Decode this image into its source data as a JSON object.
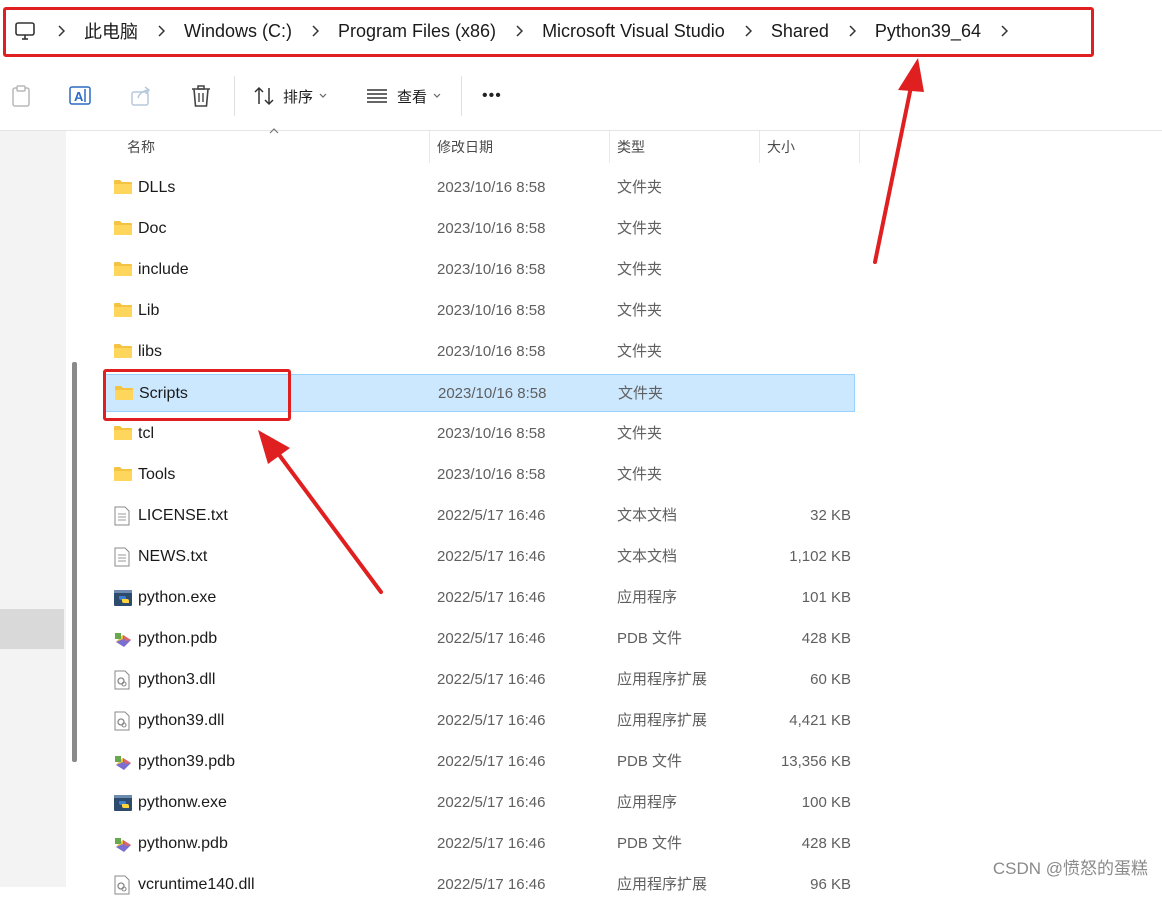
{
  "breadcrumb": {
    "items": [
      "此电脑",
      "Windows (C:)",
      "Program Files (x86)",
      "Microsoft Visual Studio",
      "Shared",
      "Python39_64"
    ]
  },
  "toolbar": {
    "sort_label": "排序",
    "view_label": "查看",
    "more_label": "•••"
  },
  "columns": {
    "name": "名称",
    "date": "修改日期",
    "type": "类型",
    "size": "大小"
  },
  "files": [
    {
      "name": "DLLs",
      "date": "2023/10/16 8:58",
      "type": "文件夹",
      "size": "",
      "icon": "folder-icon"
    },
    {
      "name": "Doc",
      "date": "2023/10/16 8:58",
      "type": "文件夹",
      "size": "",
      "icon": "folder-icon"
    },
    {
      "name": "include",
      "date": "2023/10/16 8:58",
      "type": "文件夹",
      "size": "",
      "icon": "folder-icon"
    },
    {
      "name": "Lib",
      "date": "2023/10/16 8:58",
      "type": "文件夹",
      "size": "",
      "icon": "folder-icon"
    },
    {
      "name": "libs",
      "date": "2023/10/16 8:58",
      "type": "文件夹",
      "size": "",
      "icon": "folder-icon"
    },
    {
      "name": "Scripts",
      "date": "2023/10/16 8:58",
      "type": "文件夹",
      "size": "",
      "icon": "folder-icon",
      "selected": true
    },
    {
      "name": "tcl",
      "date": "2023/10/16 8:58",
      "type": "文件夹",
      "size": "",
      "icon": "folder-icon"
    },
    {
      "name": "Tools",
      "date": "2023/10/16 8:58",
      "type": "文件夹",
      "size": "",
      "icon": "folder-icon"
    },
    {
      "name": "LICENSE.txt",
      "date": "2022/5/17 16:46",
      "type": "文本文档",
      "size": "32 KB",
      "icon": "text-file-icon"
    },
    {
      "name": "NEWS.txt",
      "date": "2022/5/17 16:46",
      "type": "文本文档",
      "size": "1,102 KB",
      "icon": "text-file-icon"
    },
    {
      "name": "python.exe",
      "date": "2022/5/17 16:46",
      "type": "应用程序",
      "size": "101 KB",
      "icon": "python-exe-icon"
    },
    {
      "name": "python.pdb",
      "date": "2022/5/17 16:46",
      "type": "PDB 文件",
      "size": "428 KB",
      "icon": "pdb-file-icon"
    },
    {
      "name": "python3.dll",
      "date": "2022/5/17 16:46",
      "type": "应用程序扩展",
      "size": "60 KB",
      "icon": "dll-file-icon"
    },
    {
      "name": "python39.dll",
      "date": "2022/5/17 16:46",
      "type": "应用程序扩展",
      "size": "4,421 KB",
      "icon": "dll-file-icon"
    },
    {
      "name": "python39.pdb",
      "date": "2022/5/17 16:46",
      "type": "PDB 文件",
      "size": "13,356 KB",
      "icon": "pdb-file-icon"
    },
    {
      "name": "pythonw.exe",
      "date": "2022/5/17 16:46",
      "type": "应用程序",
      "size": "100 KB",
      "icon": "python-exe-icon"
    },
    {
      "name": "pythonw.pdb",
      "date": "2022/5/17 16:46",
      "type": "PDB 文件",
      "size": "428 KB",
      "icon": "pdb-file-icon"
    },
    {
      "name": "vcruntime140.dll",
      "date": "2022/5/17 16:46",
      "type": "应用程序扩展",
      "size": "96 KB",
      "icon": "dll-file-icon"
    }
  ],
  "watermark": "CSDN @愤怒的蛋糕",
  "colors": {
    "selection_bg": "#cce8ff",
    "selection_border": "#99d1ff",
    "annotation_red": "#e02020"
  }
}
